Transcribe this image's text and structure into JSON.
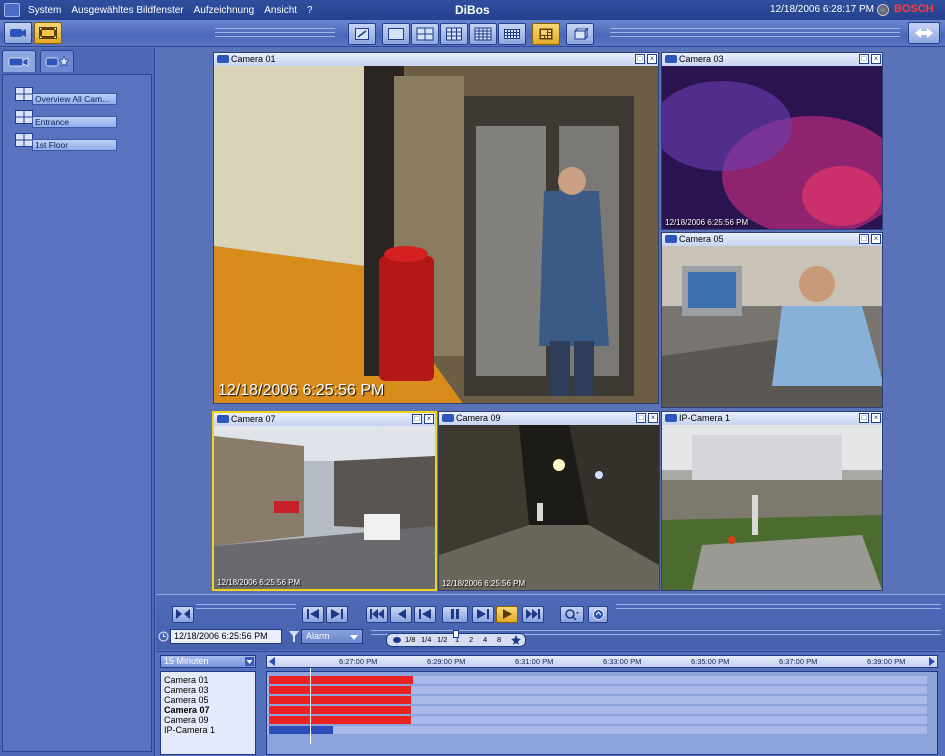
{
  "menubar": {
    "items": [
      "System",
      "Ausgewähltes Bildfenster",
      "Aufzeichnung",
      "Ansicht",
      "?"
    ],
    "title": "DiBos",
    "datetime": "12/18/2006 6:28:17 PM",
    "brand": "BOSCH"
  },
  "toolbar": {
    "left_buttons": [
      "live-mode",
      "playback-mode"
    ],
    "layout_buttons": [
      "fullscreen",
      "layout-1x1",
      "layout-2x2",
      "layout-3x3",
      "layout-4x4",
      "layout-5x5",
      "layout-custom",
      "layout-3d"
    ],
    "active_layout": "layout-custom",
    "accent": "#e6b12c"
  },
  "sidebar": {
    "tabs": [
      "cameras-tab",
      "favorites-tab"
    ],
    "items": [
      {
        "label": "Overview All Cam..."
      },
      {
        "label": "Entrance"
      },
      {
        "label": "1st Floor"
      }
    ]
  },
  "panes": [
    {
      "title": "Camera 01",
      "timestamp": "12/18/2006 6:25:56 PM"
    },
    {
      "title": "Camera 03",
      "timestamp": "12/18/2006 6:25:56 PM"
    },
    {
      "title": "Camera 05",
      "timestamp": ""
    },
    {
      "title": "Camera 07",
      "timestamp": "12/18/2006 6:25:56 PM",
      "selected": true
    },
    {
      "title": "Camera 09",
      "timestamp": "12/18/2006 6:25:56 PM"
    },
    {
      "title": "IP-Camera 1",
      "timestamp": ""
    }
  ],
  "playback": {
    "date": "12/18/2006   6:25:56 PM",
    "filter": "Alarm",
    "speeds": [
      "1/8",
      "1/4",
      "1/2",
      "1",
      "2",
      "4",
      "8"
    ]
  },
  "timeline": {
    "range": "15 Minuten",
    "ticks": [
      "6:27:00 PM",
      "6:29:00 PM",
      "6:31:00 PM",
      "6:33:00 PM",
      "6:35:00 PM",
      "6:37:00 PM",
      "6:39:00 PM"
    ],
    "cameras": [
      {
        "name": "Camera 01",
        "bold": false,
        "color": "#ea2121"
      },
      {
        "name": "Camera 03",
        "bold": false,
        "color": "#ea2121"
      },
      {
        "name": "Camera 05",
        "bold": false,
        "color": "#ea2121"
      },
      {
        "name": "Camera 07",
        "bold": true,
        "color": "#ea2121"
      },
      {
        "name": "Camera 09",
        "bold": false,
        "color": "#ea2121"
      },
      {
        "name": "IP-Camera 1",
        "bold": false,
        "color": "#2c4db8"
      }
    ]
  }
}
